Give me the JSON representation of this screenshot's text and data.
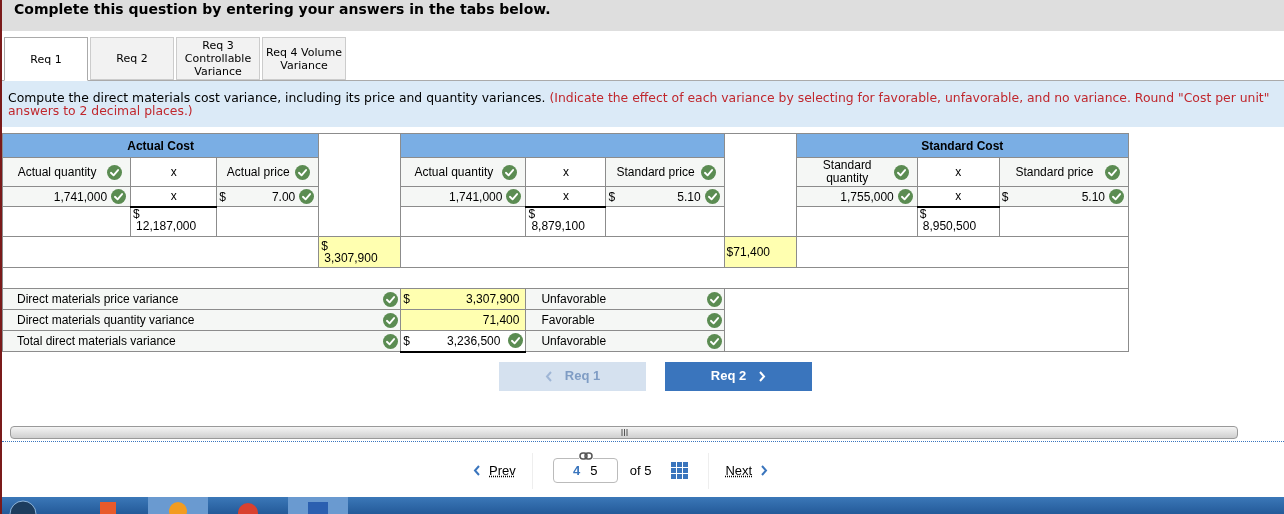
{
  "prompt": "Complete this question by entering your answers in the tabs below.",
  "tabs": [
    {
      "lines": [
        "Req 1"
      ],
      "selected": true
    },
    {
      "lines": [
        "Req 2"
      ],
      "selected": false
    },
    {
      "lines": [
        "Req 3",
        "Controllable",
        "Variance"
      ],
      "selected": false
    },
    {
      "lines": [
        "Req 4 Volume",
        "Variance"
      ],
      "selected": false
    }
  ],
  "instructions": {
    "text": "Compute the direct materials cost variance, including its price and quantity variances.",
    "note": "(Indicate the effect of each variance by selecting for favorable, unfavorable, and no variance. Round \"Cost per unit\" answers to 2 decimal places.)"
  },
  "sections": [
    {
      "title": "Actual Cost",
      "labels": [
        {
          "text": "Actual quantity",
          "correct": true
        },
        {
          "text": "x"
        },
        {
          "text": "Actual price",
          "correct": true
        }
      ],
      "values": [
        {
          "text": "1,741,000",
          "correct": true
        },
        {
          "text": "x"
        },
        {
          "currency": "$",
          "text": "7.00",
          "correct": true
        }
      ],
      "product": {
        "currency": "$",
        "amount": "12,187,000"
      }
    },
    {
      "labels": [
        {
          "text": "Actual quantity",
          "correct": true
        },
        {
          "text": "x"
        },
        {
          "text": "Standard price",
          "correct": true
        }
      ],
      "values": [
        {
          "text": "1,741,000",
          "correct": true
        },
        {
          "text": "x"
        },
        {
          "currency": "$",
          "text": "5.10",
          "correct": true
        }
      ],
      "product": {
        "currency": "$",
        "amount": "8,879,100"
      }
    },
    {
      "title": "Standard Cost",
      "labels": [
        {
          "text": "Standard quantity",
          "correct": true
        },
        {
          "text": "x"
        },
        {
          "text": "Standard price",
          "correct": true
        }
      ],
      "values": [
        {
          "text": "1,755,000",
          "correct": true
        },
        {
          "text": "x"
        },
        {
          "currency": "$",
          "text": "5.10",
          "correct": true
        }
      ],
      "product": {
        "currency": "$",
        "amount": "8,950,500"
      }
    }
  ],
  "differences": [
    {
      "currency": "$",
      "amount": "3,307,900",
      "stacked": true
    },
    {
      "currency": "$",
      "amount": "71,400",
      "stacked": false
    }
  ],
  "variances": [
    {
      "label": "Direct materials price variance",
      "label_correct": true,
      "currency": "$",
      "amount": "3,307,900",
      "highlighted": true,
      "amount_correct": false,
      "effect": "Unfavorable",
      "effect_correct": true
    },
    {
      "label": "Direct materials quantity variance",
      "label_correct": true,
      "amount": "71,400",
      "highlighted": true,
      "amount_correct": false,
      "effect": "Favorable",
      "effect_correct": true
    },
    {
      "label": "Total direct materials variance",
      "label_correct": true,
      "currency": "$",
      "amount": "3,236,500",
      "highlighted": false,
      "amount_correct": true,
      "effect": "Unfavorable",
      "effect_correct": true
    }
  ],
  "nav_buttons": [
    {
      "label": "Req 1",
      "kind": "prev",
      "disabled": true
    },
    {
      "label": "Req 2",
      "kind": "next",
      "disabled": false
    }
  ],
  "pager": {
    "prev": "Prev",
    "current": "4",
    "page_field": "5",
    "total": "of 5",
    "next": "Next"
  }
}
